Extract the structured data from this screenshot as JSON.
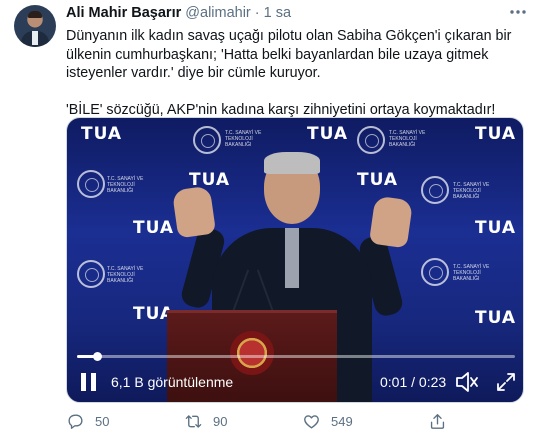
{
  "tweet": {
    "author_name": "Ali Mahir Başarır",
    "handle": "@alimahir",
    "separator": "·",
    "time": "1 sa",
    "more_icon": "more-dots-icon",
    "paragraphs": [
      "Dünyanın ilk kadın savaş uçağı pilotu olan Sabiha Gökçen'i çıkaran bir ülkenin cumhurbaşkanı; 'Hatta belki bayanlardan bile uzaya gitmek isteyenler vardır.' diye bir cümle kuruyor.",
      "'BİLE' sözcüğü, AKP'nin kadına karşı zihniyetini ortaya koymaktadır!"
    ]
  },
  "video": {
    "backdrop_logo": "TUA",
    "backdrop_caption": "T.C. SANAYİ VE TEKNOLOJİ BAKANLIĞI",
    "views": "6,1 B görüntülenme",
    "time_readout": "0:01 / 0:23",
    "progress": 0.045,
    "pause_icon": "pause-icon",
    "mute_icon": "speaker-muted-icon",
    "fullscreen_icon": "fullscreen-icon"
  },
  "actions": {
    "reply_count": "50",
    "retweet_count": "90",
    "like_count": "549",
    "icons": [
      "reply-icon",
      "retweet-icon",
      "like-icon",
      "share-icon"
    ]
  },
  "colors": {
    "text_primary": "#0f1419",
    "text_secondary": "#5b7083",
    "video_background": "#1b2e92"
  }
}
